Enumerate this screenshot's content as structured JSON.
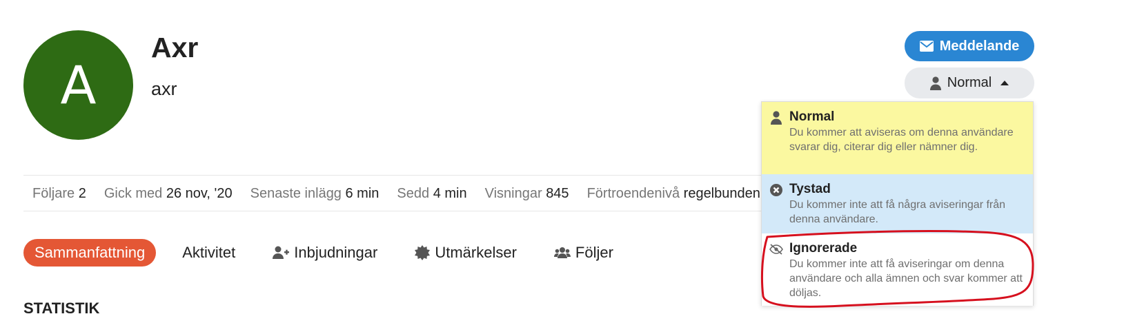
{
  "profile": {
    "avatar_letter": "A",
    "avatar_color": "#2e6b14",
    "display_name": "Axr",
    "username": "axr"
  },
  "stats": [
    {
      "label": "Följare",
      "value": "2"
    },
    {
      "label": "Gick med",
      "value": "26 nov, '20"
    },
    {
      "label": "Senaste inlägg",
      "value": "6 min"
    },
    {
      "label": "Sedd",
      "value": "4 min"
    },
    {
      "label": "Visningar",
      "value": "845"
    },
    {
      "label": "Förtroendenivå",
      "value": "regelbunden"
    }
  ],
  "nav": {
    "summary": "Sammanfattning",
    "activity": "Aktivitet",
    "invites": "Inbjudningar",
    "badges": "Utmärkelser",
    "follows": "Följer"
  },
  "section_title": "STATISTIK",
  "actions": {
    "message_label": "Meddelande",
    "notification_level_label": "Normal"
  },
  "notification_menu": [
    {
      "title": "Normal",
      "description": "Du kommer att aviseras om denna användare svarar dig, citerar dig eller nämner dig.",
      "icon": "user-icon"
    },
    {
      "title": "Tystad",
      "description": "Du kommer inte att få några aviseringar från denna användare.",
      "icon": "circle-x-icon"
    },
    {
      "title": "Ignorerade",
      "description": "Du kommer inte att få aviseringar om denna användare och alla ämnen och svar kommer att döljas.",
      "icon": "eye-slash-icon"
    }
  ],
  "colors": {
    "accent": "#e45735",
    "primary": "#2a86d3",
    "normal_bg": "#fbf8a0",
    "muted_bg": "#d3e9f9",
    "annotation": "#d6101e"
  }
}
